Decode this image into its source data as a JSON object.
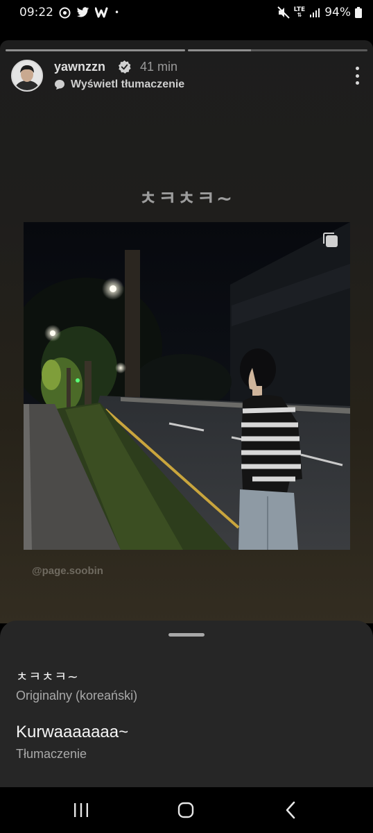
{
  "status_bar": {
    "time": "09:22",
    "left_icons": [
      "threads-icon",
      "twitter-icon",
      "weverse-icon"
    ],
    "dot": "•",
    "network": "LTE",
    "battery": "94%"
  },
  "story": {
    "progress": [
      1.0,
      0.35
    ],
    "username": "yawnzzn",
    "time_ago": "41 min",
    "translate_label": "Wyświetl tłumaczenie",
    "caption": "ㅊㅋㅊㅋ~",
    "credit": "@page.soobin"
  },
  "translation_sheet": {
    "original_text": "ㅊㅋㅊㅋ~",
    "original_label": "Originalny (koreański)",
    "translated_text": "Kurwaaaaaaa~",
    "translated_label": "Tłumaczenie"
  },
  "nav": {
    "icons": [
      "recents-icon",
      "home-icon",
      "back-icon"
    ]
  },
  "colors": {
    "sheet_bg": "#262626",
    "verified": "#d0d0d0"
  }
}
